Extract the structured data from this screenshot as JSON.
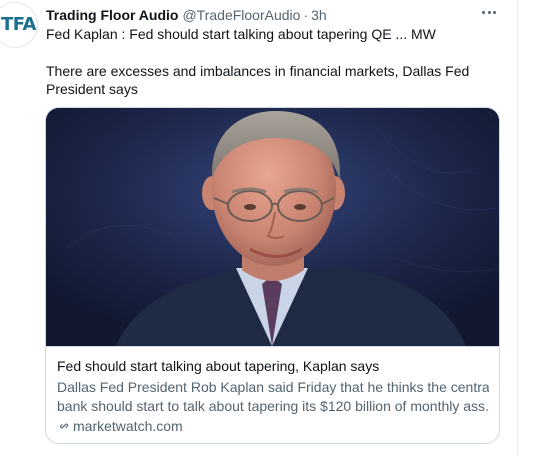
{
  "tweet": {
    "avatar_text": "TFA",
    "author_name": "Trading Floor Audio",
    "handle": "@TradeFloorAudio",
    "separator": "·",
    "time": "3h",
    "text_line1": "Fed Kaplan : Fed should start talking about tapering QE ... MW",
    "text_line2": "There are excesses and imbalances in financial markets, Dallas Fed President says"
  },
  "card": {
    "title": "Fed should start talking about tapering, Kaplan says",
    "description_line1": "Dallas Fed President Rob Kaplan said Friday that he thinks the central",
    "description_line2": "bank should start to talk about tapering its $120 billion of monthly ass...",
    "domain": "marketwatch.com"
  },
  "icons": {
    "more": "more-horizontal-icon",
    "link": "link-icon"
  },
  "colors": {
    "text_primary": "#0f1419",
    "text_secondary": "#536471",
    "card_border": "#cfd9de",
    "avatar_text": "#1b6f8f"
  }
}
